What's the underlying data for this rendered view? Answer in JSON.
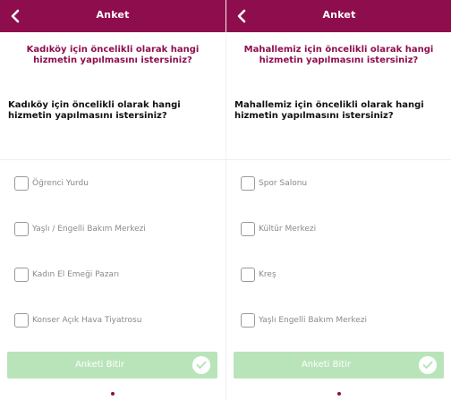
{
  "colors": {
    "accent": "#8e0e4d",
    "success_light": "#b9e4ba",
    "text_muted": "#8a8a8a"
  },
  "screens": [
    {
      "header": {
        "title": "Anket",
        "back_icon": "chevron-left-icon"
      },
      "question_heading": "Kadıköy için öncelikli olarak hangi hizmetin yapılmasını istersiniz?",
      "question_body": "Kadıköy için öncelikli olarak hangi hizmetin yapılmasını istersiniz?",
      "options": [
        {
          "label": "Öğrenci Yurdu"
        },
        {
          "label": "Yaşlı / Engelli Bakım Merkezi"
        },
        {
          "label": "Kadın El Emeği Pazarı"
        },
        {
          "label": "Konser Açık Hava Tiyatrosu"
        }
      ],
      "finish_button": {
        "label": "Anketi Bitir",
        "icon": "check-circle-icon"
      }
    },
    {
      "header": {
        "title": "Anket",
        "back_icon": "chevron-left-icon"
      },
      "question_heading": "Mahallemiz için öncelikli olarak hangi hizmetin yapılmasını istersiniz?",
      "question_body": "Mahallemiz için öncelikli olarak hangi hizmetin yapılmasını istersiniz?",
      "options": [
        {
          "label": "Spor Salonu"
        },
        {
          "label": "Kültür Merkezi"
        },
        {
          "label": "Kreş"
        },
        {
          "label": "Yaşlı Engelli Bakım Merkezi"
        }
      ],
      "finish_button": {
        "label": "Anketi Bitir",
        "icon": "check-circle-icon"
      }
    }
  ]
}
